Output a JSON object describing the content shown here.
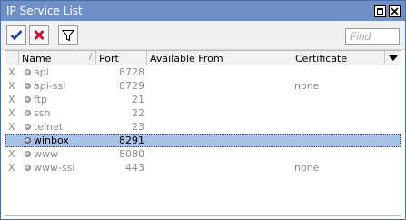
{
  "window": {
    "title": "IP Service List"
  },
  "toolbar": {
    "enable_icon": "checkmark-icon",
    "disable_icon": "x-icon",
    "filter_icon": "filter-icon",
    "find_placeholder": "Find"
  },
  "table": {
    "columns": {
      "flag": "",
      "name": "Name",
      "port": "Port",
      "available_from": "Available From",
      "certificate": "Certificate"
    },
    "sort_indicator": "/",
    "rows": [
      {
        "flag": "X",
        "name": "api",
        "port": "8728",
        "available_from": "",
        "certificate": "",
        "disabled": true,
        "selected": false
      },
      {
        "flag": "X",
        "name": "api-ssl",
        "port": "8729",
        "available_from": "",
        "certificate": "none",
        "disabled": true,
        "selected": false
      },
      {
        "flag": "X",
        "name": "ftp",
        "port": "21",
        "available_from": "",
        "certificate": "",
        "disabled": true,
        "selected": false
      },
      {
        "flag": "X",
        "name": "ssh",
        "port": "22",
        "available_from": "",
        "certificate": "",
        "disabled": true,
        "selected": false
      },
      {
        "flag": "X",
        "name": "telnet",
        "port": "23",
        "available_from": "",
        "certificate": "",
        "disabled": true,
        "selected": false
      },
      {
        "flag": "",
        "name": "winbox",
        "port": "8291",
        "available_from": "",
        "certificate": "",
        "disabled": false,
        "selected": true
      },
      {
        "flag": "X",
        "name": "www",
        "port": "8080",
        "available_from": "",
        "certificate": "",
        "disabled": true,
        "selected": false
      },
      {
        "flag": "X",
        "name": "www-ssl",
        "port": "443",
        "available_from": "",
        "certificate": "none",
        "disabled": true,
        "selected": false
      }
    ]
  },
  "colors": {
    "titlebar": "#6f8fc6",
    "selection": "#a9c3e8",
    "disabled_text": "#8a8a8a",
    "enable_check": "#1f3f9f",
    "disable_x": "#c8102e"
  }
}
